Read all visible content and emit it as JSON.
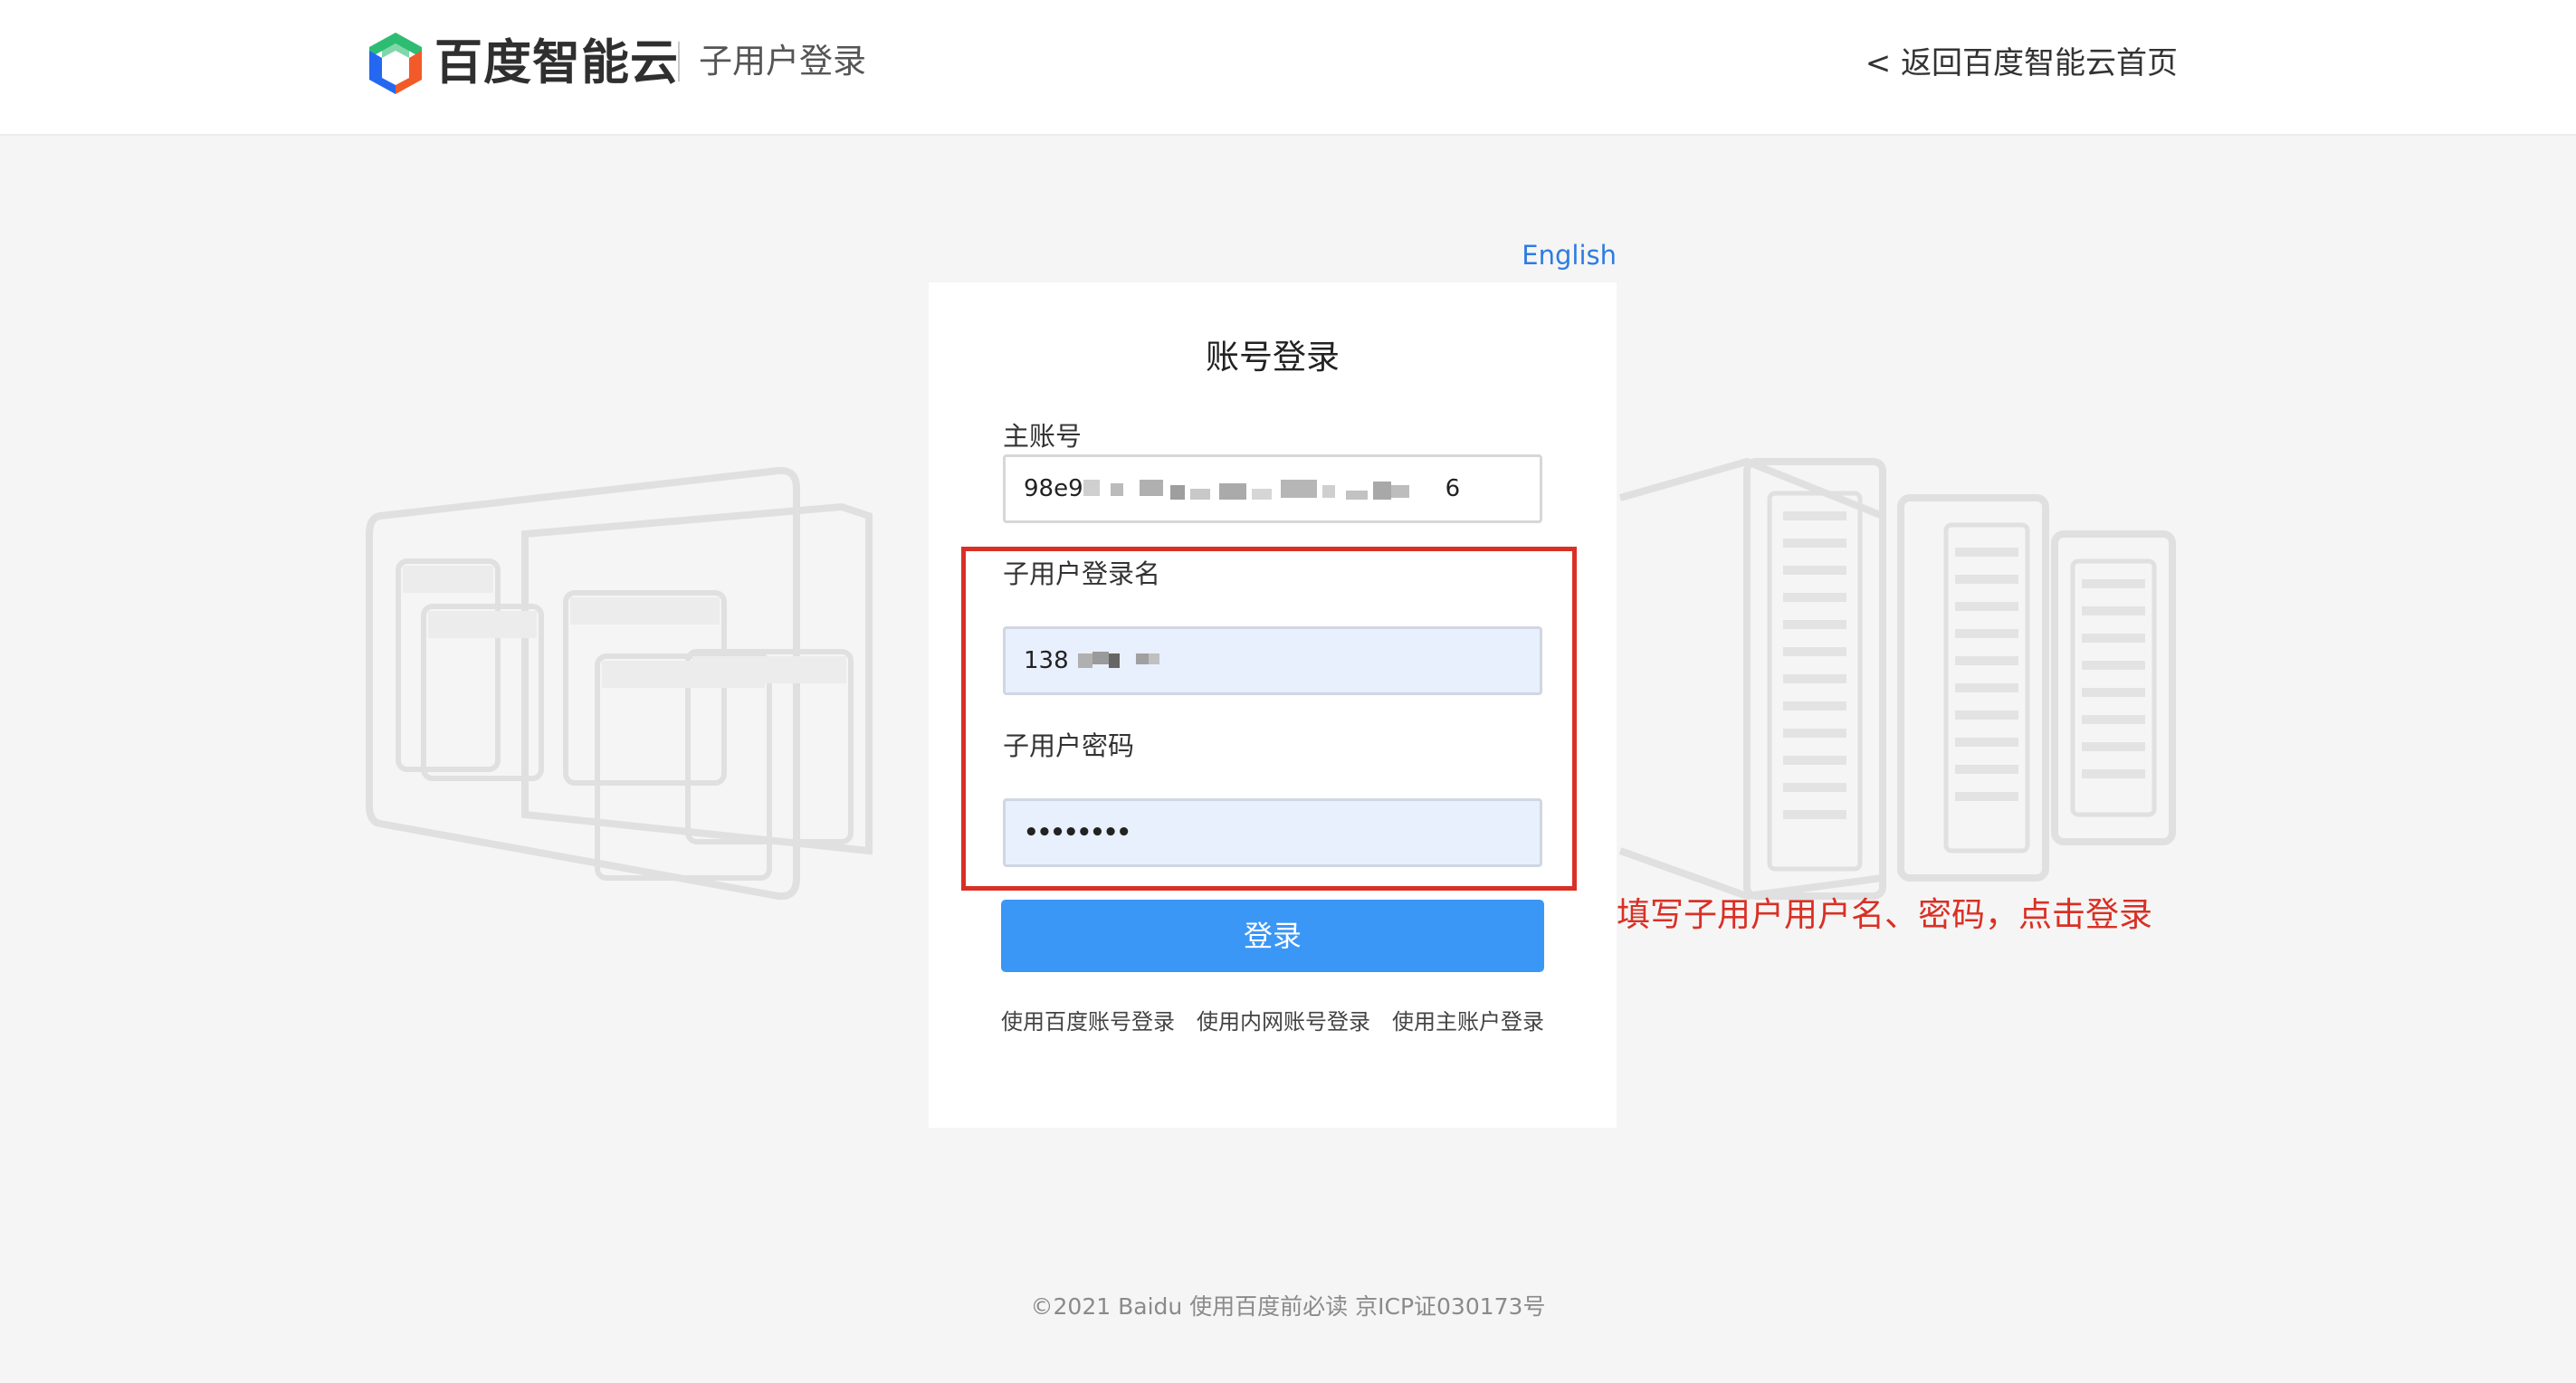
{
  "header": {
    "logo_text": "百度智能云",
    "subtitle": "子用户登录",
    "back_link": "< 返回百度智能云首页",
    "logo_icon": "baidu-cloud-logo-icon"
  },
  "language_link": "English",
  "login_card": {
    "title": "账号登录",
    "main_account": {
      "label": "主账号",
      "value_prefix": "98e9",
      "value_suffix": "6"
    },
    "sub_user_name": {
      "label": "子用户登录名",
      "value_prefix": "138"
    },
    "sub_user_password": {
      "label": "子用户密码",
      "value": "••••••••"
    },
    "login_button": "登录",
    "alt_links": [
      "使用百度账号登录",
      "使用内网账号登录",
      "使用主账户登录"
    ]
  },
  "annotation": {
    "text": "填写子用户用户名、密码，点击登录",
    "color": "#d93025"
  },
  "footer": {
    "text": "©2021 Baidu 使用百度前必读 京ICP证030173号"
  },
  "colors": {
    "accent": "#3a97f6",
    "link": "#2e7ce0",
    "highlight": "#d93025"
  }
}
